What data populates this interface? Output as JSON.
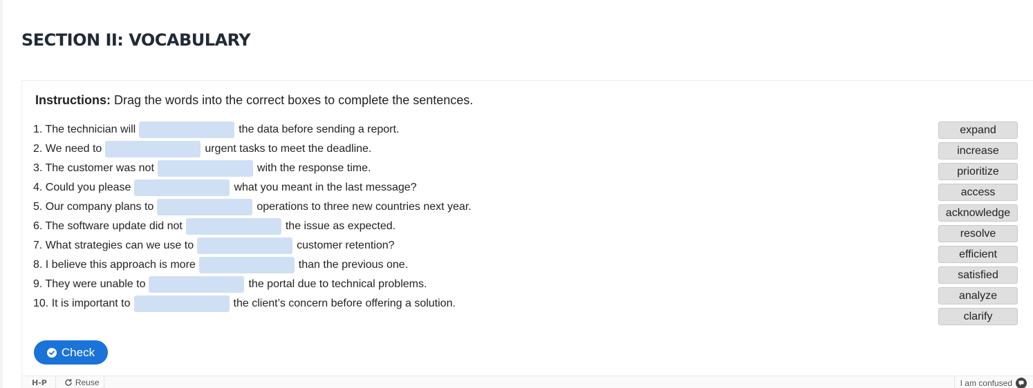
{
  "section": {
    "title": "SECTION II: VOCABULARY"
  },
  "instructions": {
    "label": "Instructions:",
    "text": " Drag the words into the correct boxes to complete the sentences."
  },
  "sentences": [
    {
      "before": "1. The technician will",
      "after": "the data before sending a report."
    },
    {
      "before": "2. We need to",
      "after": "urgent tasks to meet the deadline."
    },
    {
      "before": "3. The customer was not",
      "after": "with the response time."
    },
    {
      "before": "4. Could you please",
      "after": "what you meant in the last message?"
    },
    {
      "before": "5. Our company plans to",
      "after": "operations to three new countries next year."
    },
    {
      "before": "6. The software update did not",
      "after": "the issue as expected."
    },
    {
      "before": "7. What strategies can we use to",
      "after": "customer retention?"
    },
    {
      "before": "8. I believe this approach is more",
      "after": "than the previous one."
    },
    {
      "before": "9. They were unable to",
      "after": "the portal due to technical problems."
    },
    {
      "before": "10. It is important to",
      "after": "the client’s concern before offering a solution."
    }
  ],
  "word_bank": [
    "expand",
    "increase",
    "prioritize",
    "access",
    "acknowledge",
    "resolve",
    "efficient",
    "satisfied",
    "analyze",
    "clarify"
  ],
  "check_button": {
    "label": "Check",
    "icon": "check-circle-icon"
  },
  "footer": {
    "logo": "H-P",
    "reuse": "Reuse",
    "confused": "I am confused"
  },
  "colors": {
    "accent": "#1a73d9",
    "drop_zone": "#cfe0f4",
    "word_chip": "#dfdfdf",
    "title": "#212b36"
  }
}
